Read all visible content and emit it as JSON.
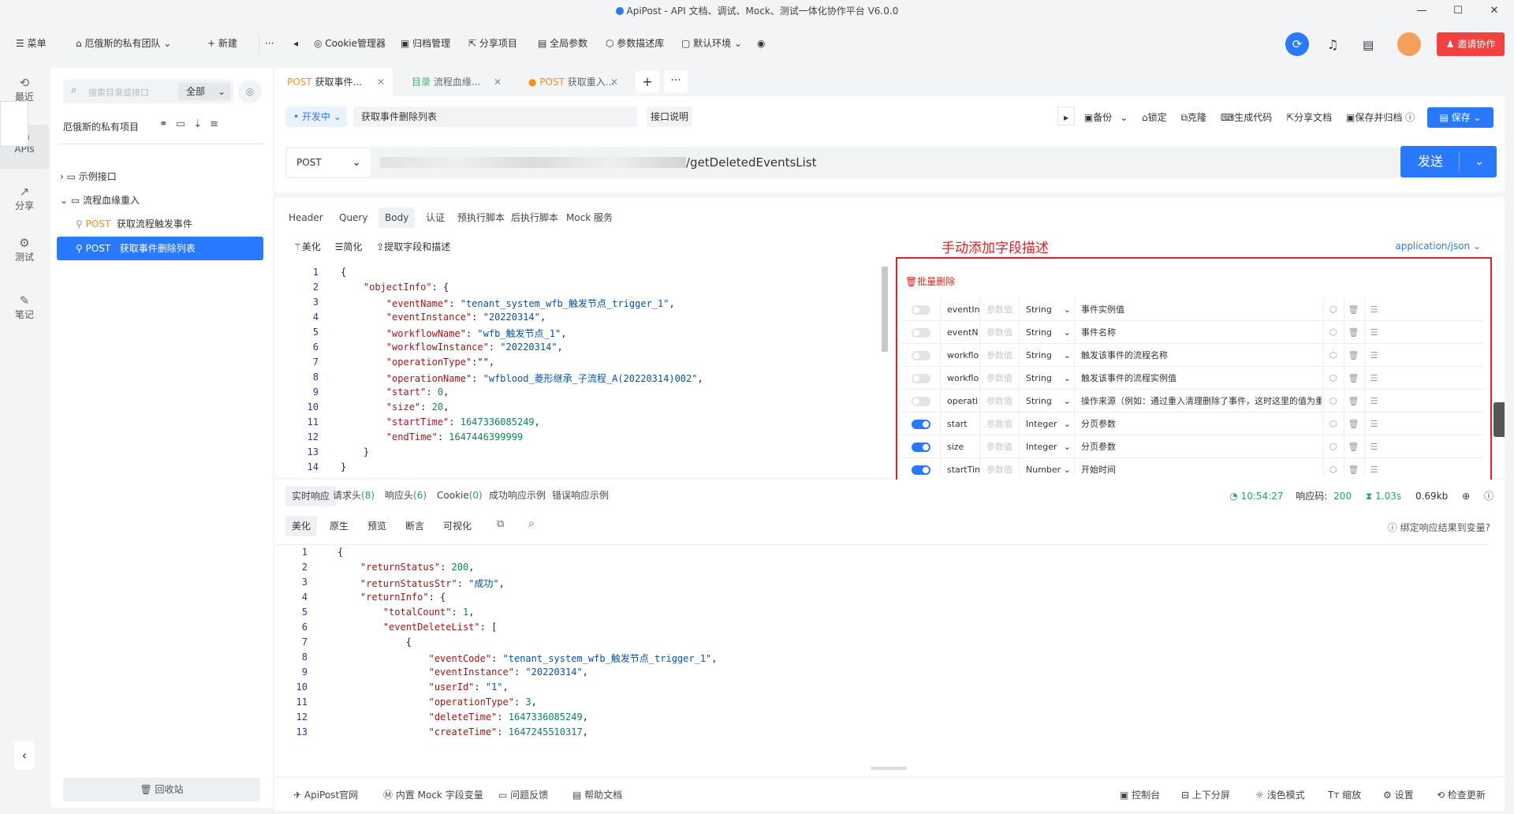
{
  "window": {
    "title": "ApiPost - API 文档、调试、Mock、测试一体化协作平台 V6.0.0",
    "minimize": "—",
    "maximize": "☐",
    "close": "✕"
  },
  "topbar": {
    "menu": "菜单",
    "team": "厄俄斯的私有团队",
    "new": "新建",
    "more": "···",
    "cookie": "Cookie管理器",
    "archive": "归档管理",
    "share_project": "分享项目",
    "global_params": "全局参数",
    "param_lib": "参数描述库",
    "env": "默认环境",
    "invite": "邀请协作"
  },
  "rail": [
    {
      "label": "最近",
      "icon": "⟲"
    },
    {
      "label": "APIs",
      "icon": "▭"
    },
    {
      "label": "分享",
      "icon": "↗"
    },
    {
      "label": "测试",
      "icon": "⚙"
    },
    {
      "label": "笔记",
      "icon": "✎"
    }
  ],
  "sidebar": {
    "search_placeholder": "搜索目录或接口",
    "filter": "全部",
    "project": "厄俄斯的私有项目",
    "tree": [
      {
        "label": "示例接口"
      },
      {
        "label": "流程血缘重入"
      },
      {
        "method": "POST",
        "label": "获取流程触发事件"
      },
      {
        "method": "POST",
        "label": "获取事件删除列表"
      }
    ],
    "recycle": "回收站"
  },
  "tabs": [
    {
      "method": "POST",
      "label": "获取事件..."
    },
    {
      "method": "目录",
      "label": "流程血缘..."
    },
    {
      "method": "POST",
      "label": "获取重入..."
    }
  ],
  "request": {
    "status": "开发中",
    "name": "获取事件删除列表",
    "doc_btn": "接口说明",
    "backup": "备份",
    "lock": "锁定",
    "clone": "克隆",
    "gen_code": "生成代码",
    "share_doc": "分享文档",
    "save_archive": "保存并归档",
    "save": "保存",
    "method": "POST",
    "url_visible": "/getDeletedEventsList",
    "send": "发送"
  },
  "req_tabs": [
    "Header",
    "Query",
    "Body",
    "认证",
    "预执行脚本",
    "后执行脚本",
    "Mock 服务"
  ],
  "body_tools": {
    "beautify": "美化",
    "simplify": "简化",
    "extract": "提取字段和描述",
    "content_type": "application/json"
  },
  "annotation": "手动添加字段描述",
  "body_lines": [
    [
      {
        "t": "{",
        "c": "p"
      }
    ],
    [
      {
        "t": "    ",
        "c": "p"
      },
      {
        "t": "\"objectInfo\"",
        "c": "k"
      },
      {
        "t": ": {",
        "c": "p"
      }
    ],
    [
      {
        "t": "        ",
        "c": "p"
      },
      {
        "t": "\"eventName\"",
        "c": "k"
      },
      {
        "t": ": ",
        "c": "p"
      },
      {
        "t": "\"tenant_system_wfb_触发节点_trigger_1\"",
        "c": "s"
      },
      {
        "t": ",",
        "c": "p"
      }
    ],
    [
      {
        "t": "        ",
        "c": "p"
      },
      {
        "t": "\"eventInstance\"",
        "c": "k"
      },
      {
        "t": ": ",
        "c": "p"
      },
      {
        "t": "\"20220314\"",
        "c": "s"
      },
      {
        "t": ",",
        "c": "p"
      }
    ],
    [
      {
        "t": "        ",
        "c": "p"
      },
      {
        "t": "\"workflowName\"",
        "c": "k"
      },
      {
        "t": ": ",
        "c": "p"
      },
      {
        "t": "\"wfb_触发节点_1\"",
        "c": "s"
      },
      {
        "t": ",",
        "c": "p"
      }
    ],
    [
      {
        "t": "        ",
        "c": "p"
      },
      {
        "t": "\"workflowInstance\"",
        "c": "k"
      },
      {
        "t": ": ",
        "c": "p"
      },
      {
        "t": "\"20220314\"",
        "c": "s"
      },
      {
        "t": ",",
        "c": "p"
      }
    ],
    [
      {
        "t": "        ",
        "c": "p"
      },
      {
        "t": "\"operationType\"",
        "c": "k"
      },
      {
        "t": ":\"\",",
        "c": "p"
      }
    ],
    [
      {
        "t": "        ",
        "c": "p"
      },
      {
        "t": "\"operationName\"",
        "c": "k"
      },
      {
        "t": ": ",
        "c": "p"
      },
      {
        "t": "\"wfblood_菱形继承_子流程_A(20220314)002\"",
        "c": "s"
      },
      {
        "t": ",",
        "c": "p"
      }
    ],
    [
      {
        "t": "        ",
        "c": "p"
      },
      {
        "t": "\"start\"",
        "c": "k"
      },
      {
        "t": ": ",
        "c": "p"
      },
      {
        "t": "0",
        "c": "n"
      },
      {
        "t": ",",
        "c": "p"
      }
    ],
    [
      {
        "t": "        ",
        "c": "p"
      },
      {
        "t": "\"size\"",
        "c": "k"
      },
      {
        "t": ": ",
        "c": "p"
      },
      {
        "t": "20",
        "c": "n"
      },
      {
        "t": ",",
        "c": "p"
      }
    ],
    [
      {
        "t": "        ",
        "c": "p"
      },
      {
        "t": "\"startTime\"",
        "c": "k"
      },
      {
        "t": ": ",
        "c": "p"
      },
      {
        "t": "1647336085249",
        "c": "n"
      },
      {
        "t": ",",
        "c": "p"
      }
    ],
    [
      {
        "t": "        ",
        "c": "p"
      },
      {
        "t": "\"endTime\"",
        "c": "k"
      },
      {
        "t": ": ",
        "c": "p"
      },
      {
        "t": "1647446399999",
        "c": "n"
      }
    ],
    [
      {
        "t": "    }",
        "c": "p"
      }
    ],
    [
      {
        "t": "}",
        "c": "p"
      }
    ]
  ],
  "fields": {
    "batch_delete": "批量删除",
    "value_placeholder": "参数值",
    "rows": [
      {
        "key": "eventIn",
        "type": "String",
        "desc": "事件实例值",
        "on": false
      },
      {
        "key": "eventN",
        "type": "String",
        "desc": "事件名称",
        "on": false
      },
      {
        "key": "workflo",
        "type": "String",
        "desc": "触发该事件的流程名称",
        "on": false
      },
      {
        "key": "workflo",
        "type": "String",
        "desc": "触发该事件的流程实例值",
        "on": false
      },
      {
        "key": "operati",
        "type": "String",
        "desc": "操作来源（例如：通过重入清理删除了事件，这时这里的值为重入作业",
        "on": false
      },
      {
        "key": "start",
        "type": "Integer",
        "desc": "分页参数",
        "on": true
      },
      {
        "key": "size",
        "type": "Integer",
        "desc": "分页参数",
        "on": true
      },
      {
        "key": "startTin",
        "type": "Number",
        "desc": "开始时间",
        "on": true
      }
    ]
  },
  "resp_tabs": [
    {
      "label": "实时响应"
    },
    {
      "label": "请求头",
      "count": "8"
    },
    {
      "label": "响应头",
      "count": "6"
    },
    {
      "label": "Cookie",
      "count": "0"
    },
    {
      "label": "成功响应示例"
    },
    {
      "label": "错误响应示例"
    }
  ],
  "resp_meta": {
    "time": "10:54:27",
    "code_label": "响应码:",
    "code": "200",
    "duration": "1.03s",
    "size": "0.69kb"
  },
  "resp_views": [
    "美化",
    "原生",
    "预览",
    "断言",
    "可视化"
  ],
  "bind_var": "绑定响应结果到变量?",
  "resp_lines": [
    [
      {
        "t": "{",
        "c": "p"
      }
    ],
    [
      {
        "t": "    ",
        "c": "p"
      },
      {
        "t": "\"returnStatus\"",
        "c": "k"
      },
      {
        "t": ": ",
        "c": "p"
      },
      {
        "t": "200",
        "c": "n"
      },
      {
        "t": ",",
        "c": "p"
      }
    ],
    [
      {
        "t": "    ",
        "c": "p"
      },
      {
        "t": "\"returnStatusStr\"",
        "c": "k"
      },
      {
        "t": ": ",
        "c": "p"
      },
      {
        "t": "\"成功\"",
        "c": "s"
      },
      {
        "t": ",",
        "c": "p"
      }
    ],
    [
      {
        "t": "    ",
        "c": "p"
      },
      {
        "t": "\"returnInfo\"",
        "c": "k"
      },
      {
        "t": ": {",
        "c": "p"
      }
    ],
    [
      {
        "t": "        ",
        "c": "p"
      },
      {
        "t": "\"totalCount\"",
        "c": "k"
      },
      {
        "t": ": ",
        "c": "p"
      },
      {
        "t": "1",
        "c": "n"
      },
      {
        "t": ",",
        "c": "p"
      }
    ],
    [
      {
        "t": "        ",
        "c": "p"
      },
      {
        "t": "\"eventDeleteList\"",
        "c": "k"
      },
      {
        "t": ": [",
        "c": "p"
      }
    ],
    [
      {
        "t": "            {",
        "c": "p"
      }
    ],
    [
      {
        "t": "                ",
        "c": "p"
      },
      {
        "t": "\"eventCode\"",
        "c": "k"
      },
      {
        "t": ": ",
        "c": "p"
      },
      {
        "t": "\"tenant_system_wfb_触发节点_trigger_1\"",
        "c": "s"
      },
      {
        "t": ",",
        "c": "p"
      }
    ],
    [
      {
        "t": "                ",
        "c": "p"
      },
      {
        "t": "\"eventInstance\"",
        "c": "k"
      },
      {
        "t": ": ",
        "c": "p"
      },
      {
        "t": "\"20220314\"",
        "c": "s"
      },
      {
        "t": ",",
        "c": "p"
      }
    ],
    [
      {
        "t": "                ",
        "c": "p"
      },
      {
        "t": "\"userId\"",
        "c": "k"
      },
      {
        "t": ": ",
        "c": "p"
      },
      {
        "t": "\"1\"",
        "c": "s"
      },
      {
        "t": ",",
        "c": "p"
      }
    ],
    [
      {
        "t": "                ",
        "c": "p"
      },
      {
        "t": "\"operationType\"",
        "c": "k"
      },
      {
        "t": ": ",
        "c": "p"
      },
      {
        "t": "3",
        "c": "n"
      },
      {
        "t": ",",
        "c": "p"
      }
    ],
    [
      {
        "t": "                ",
        "c": "p"
      },
      {
        "t": "\"deleteTime\"",
        "c": "k"
      },
      {
        "t": ": ",
        "c": "p"
      },
      {
        "t": "1647336085249",
        "c": "n"
      },
      {
        "t": ",",
        "c": "p"
      }
    ],
    [
      {
        "t": "                ",
        "c": "p"
      },
      {
        "t": "\"createTime\"",
        "c": "k"
      },
      {
        "t": ": ",
        "c": "p"
      },
      {
        "t": "1647245510317",
        "c": "n"
      },
      {
        "t": ",",
        "c": "p"
      }
    ]
  ],
  "statusbar": {
    "website": "ApiPost官网",
    "mock": "内置 Mock 字段变量",
    "feedback": "问题反馈",
    "help": "帮助文档",
    "console": "控制台",
    "split": "上下分屏",
    "theme": "浅色模式",
    "zoom": "缩放",
    "settings": "设置",
    "update": "检查更新"
  },
  "colors": {
    "primary": "#2979ff",
    "post": "#ff8c1a",
    "danger": "#f24141",
    "annotation": "#e02020"
  }
}
